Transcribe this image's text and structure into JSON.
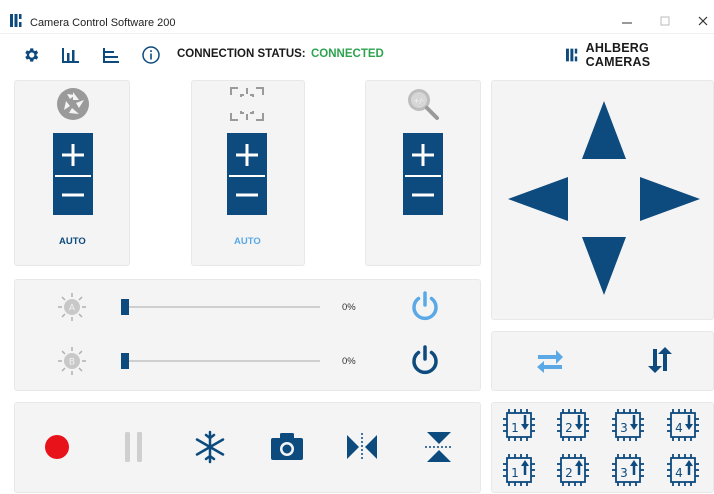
{
  "window": {
    "title": "Camera Control Software 200",
    "controls": [
      "minimize",
      "maximize",
      "close"
    ]
  },
  "toolbar": {
    "icons": [
      "settings-icon",
      "chart-icon",
      "axes-icon",
      "info-icon"
    ],
    "connection_label": "CONNECTION STATUS:",
    "connection_value": "CONNECTED",
    "brand": "AHLBERG CAMERAS"
  },
  "colors": {
    "accent": "#0d4a7e",
    "light_accent": "#5aa9e6",
    "connected": "#2ea44f",
    "record": "#e8121b",
    "panel_bg": "#f4f4f4"
  },
  "steppers": [
    {
      "name": "aperture",
      "icon": "aperture-icon",
      "auto_label": "AUTO",
      "auto_active": false
    },
    {
      "name": "focus",
      "icon": "focus-icon",
      "auto_label": "AUTO",
      "auto_active": true
    },
    {
      "name": "zoom",
      "icon": "zoom-icon"
    }
  ],
  "lights": [
    {
      "label": "A",
      "value_text": "0%",
      "value": 0,
      "power": "off"
    },
    {
      "label": "B",
      "value_text": "0%",
      "value": 0,
      "power": "on"
    }
  ],
  "pan_tilt": {
    "buttons": [
      "up",
      "left",
      "right",
      "down"
    ]
  },
  "swap": {
    "buttons": [
      "swap-horizontal",
      "swap-vertical"
    ]
  },
  "bottom_toolbar": {
    "buttons": [
      "record",
      "pause",
      "freeze",
      "snapshot",
      "mirror",
      "flip"
    ]
  },
  "presets": {
    "row1": [
      "1",
      "2",
      "3",
      "4"
    ],
    "row2": [
      "1",
      "2",
      "3",
      "4"
    ]
  }
}
